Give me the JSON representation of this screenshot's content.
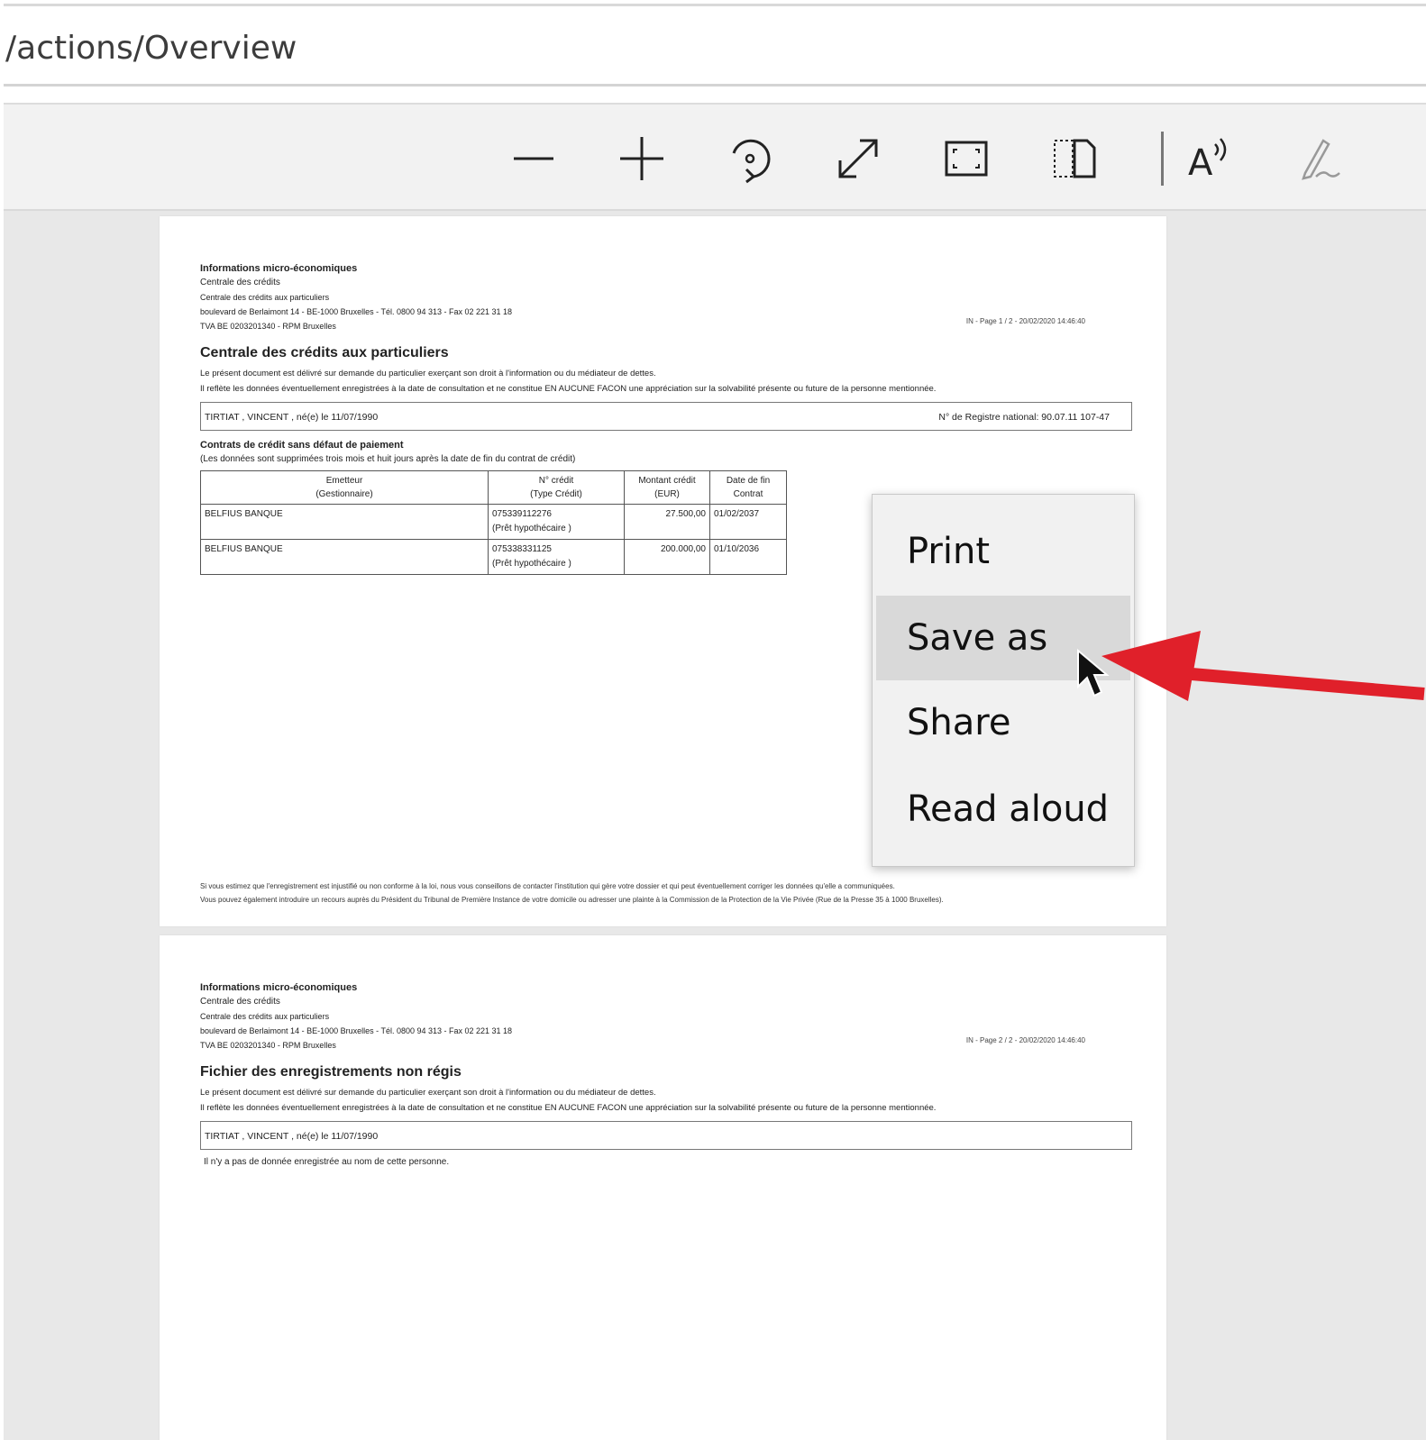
{
  "address_bar": {
    "text": "/actions/Overview"
  },
  "toolbar": {
    "buttons": [
      {
        "icon": "zoom-out-icon"
      },
      {
        "icon": "zoom-in-icon"
      },
      {
        "icon": "rotate-icon"
      },
      {
        "icon": "fit-to-width-icon"
      },
      {
        "icon": "full-screen-icon"
      },
      {
        "icon": "page-view-icon"
      },
      {
        "icon": "read-aloud-icon"
      },
      {
        "icon": "draw-icon"
      }
    ]
  },
  "page1": {
    "org_title": "Informations micro-économiques",
    "org_sub": "Centrale des crédits",
    "org_small": "Centrale des crédits aux particuliers",
    "address": "boulevard de Berlaimont 14 - BE-1000 Bruxelles - Tél. 0800 94 313 - Fax 02 221 31 18",
    "vat": "TVA BE 0203201340 - RPM Bruxelles",
    "page_ref": "IN - Page 1 / 2 - 20/02/2020 14:46:40",
    "section_title": "Centrale des crédits aux particuliers",
    "intro1": "Le présent document est délivré sur demande du particulier exerçant son droit à l'information ou du médiateur de dettes.",
    "intro2": "Il reflète les données éventuellement enregistrées à la date de consultation et ne constitue EN AUCUNE FACON une appréciation sur la solvabilité présente ou future de la personne mentionnée.",
    "person": "TIRTIAT , VINCENT , né(e) le 11/07/1990",
    "register": "N° de Registre national: 90.07.11 107-47",
    "contracts_title": "Contrats de crédit sans défaut de paiement",
    "contracts_note": "(Les données sont supprimées trois mois et huit jours après la date de fin du contrat de crédit)",
    "table": {
      "headers": [
        [
          "Emetteur",
          "(Gestionnaire)"
        ],
        [
          "N° crédit",
          "(Type Crédit)"
        ],
        [
          "Montant crédit",
          "(EUR)"
        ],
        [
          "Date de fin",
          "Contrat"
        ]
      ],
      "rows": [
        {
          "issuer": "BELFIUS BANQUE",
          "credit_no": "075339112276",
          "credit_type": "(Prêt hypothécaire )",
          "amount": "27.500,00",
          "end_date": "01/02/2037"
        },
        {
          "issuer": "BELFIUS BANQUE",
          "credit_no": "075338331125",
          "credit_type": "(Prêt hypothécaire )",
          "amount": "200.000,00",
          "end_date": "01/10/2036"
        }
      ]
    },
    "footer1": "Si vous estimez que l'enregistrement est injustifié ou non conforme à la loi, nous vous conseillons de contacter l'institution qui gère votre dossier et qui peut éventuellement corriger les données qu'elle a communiquées.",
    "footer2": "Vous pouvez également introduire un recours auprès du Président du Tribunal de Première Instance de votre domicile ou adresser une plainte à la Commission de la Protection de la Vie Privée (Rue de la Presse 35 à 1000 Bruxelles)."
  },
  "page2": {
    "org_title": "Informations micro-économiques",
    "org_sub": "Centrale des crédits",
    "org_small": "Centrale des crédits aux particuliers",
    "address": "boulevard de Berlaimont 14 - BE-1000 Bruxelles - Tél. 0800 94 313 - Fax 02 221 31 18",
    "vat": "TVA BE 0203201340 - RPM Bruxelles",
    "page_ref": "IN - Page 2 / 2 - 20/02/2020 14:46:40",
    "section_title": "Fichier des enregistrements non régis",
    "intro1": "Le présent document est délivré sur demande du particulier exerçant son droit à l'information ou du médiateur de dettes.",
    "intro2": "Il reflète les données éventuellement enregistrées à la date de consultation et ne constitue EN AUCUNE FACON une appréciation sur la solvabilité présente ou future de la personne mentionnée.",
    "person": "TIRTIAT , VINCENT , né(e) le 11/07/1990",
    "no_data": "Il n'y a pas de donnée enregistrée au nom de cette personne."
  },
  "context_menu": {
    "items": [
      {
        "label": "Print"
      },
      {
        "label": "Save as"
      },
      {
        "label": "Share"
      },
      {
        "label": "Read aloud"
      }
    ],
    "hovered": "Save as"
  },
  "annotation": {
    "arrow_color": "#e0202a"
  }
}
